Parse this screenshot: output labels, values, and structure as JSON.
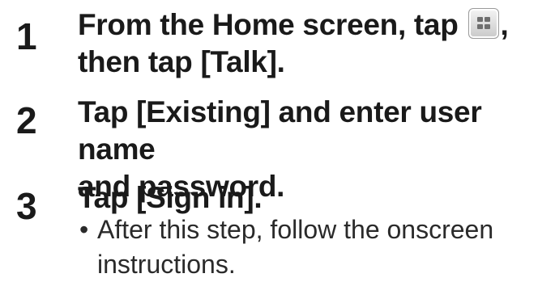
{
  "steps": [
    {
      "number": "1",
      "text_before_icon": "From the Home screen, tap",
      "icon": "apps-grid-icon",
      "text_after_icon": ",",
      "line2": "then tap [Talk]."
    },
    {
      "number": "2",
      "line1": "Tap [Existing] and enter user name",
      "line2": "and password."
    },
    {
      "number": "3",
      "line1": "Tap [Sign in].",
      "note": {
        "bullet": "•",
        "line1": "After this step, follow the onscreen",
        "line2": "instructions."
      }
    }
  ]
}
